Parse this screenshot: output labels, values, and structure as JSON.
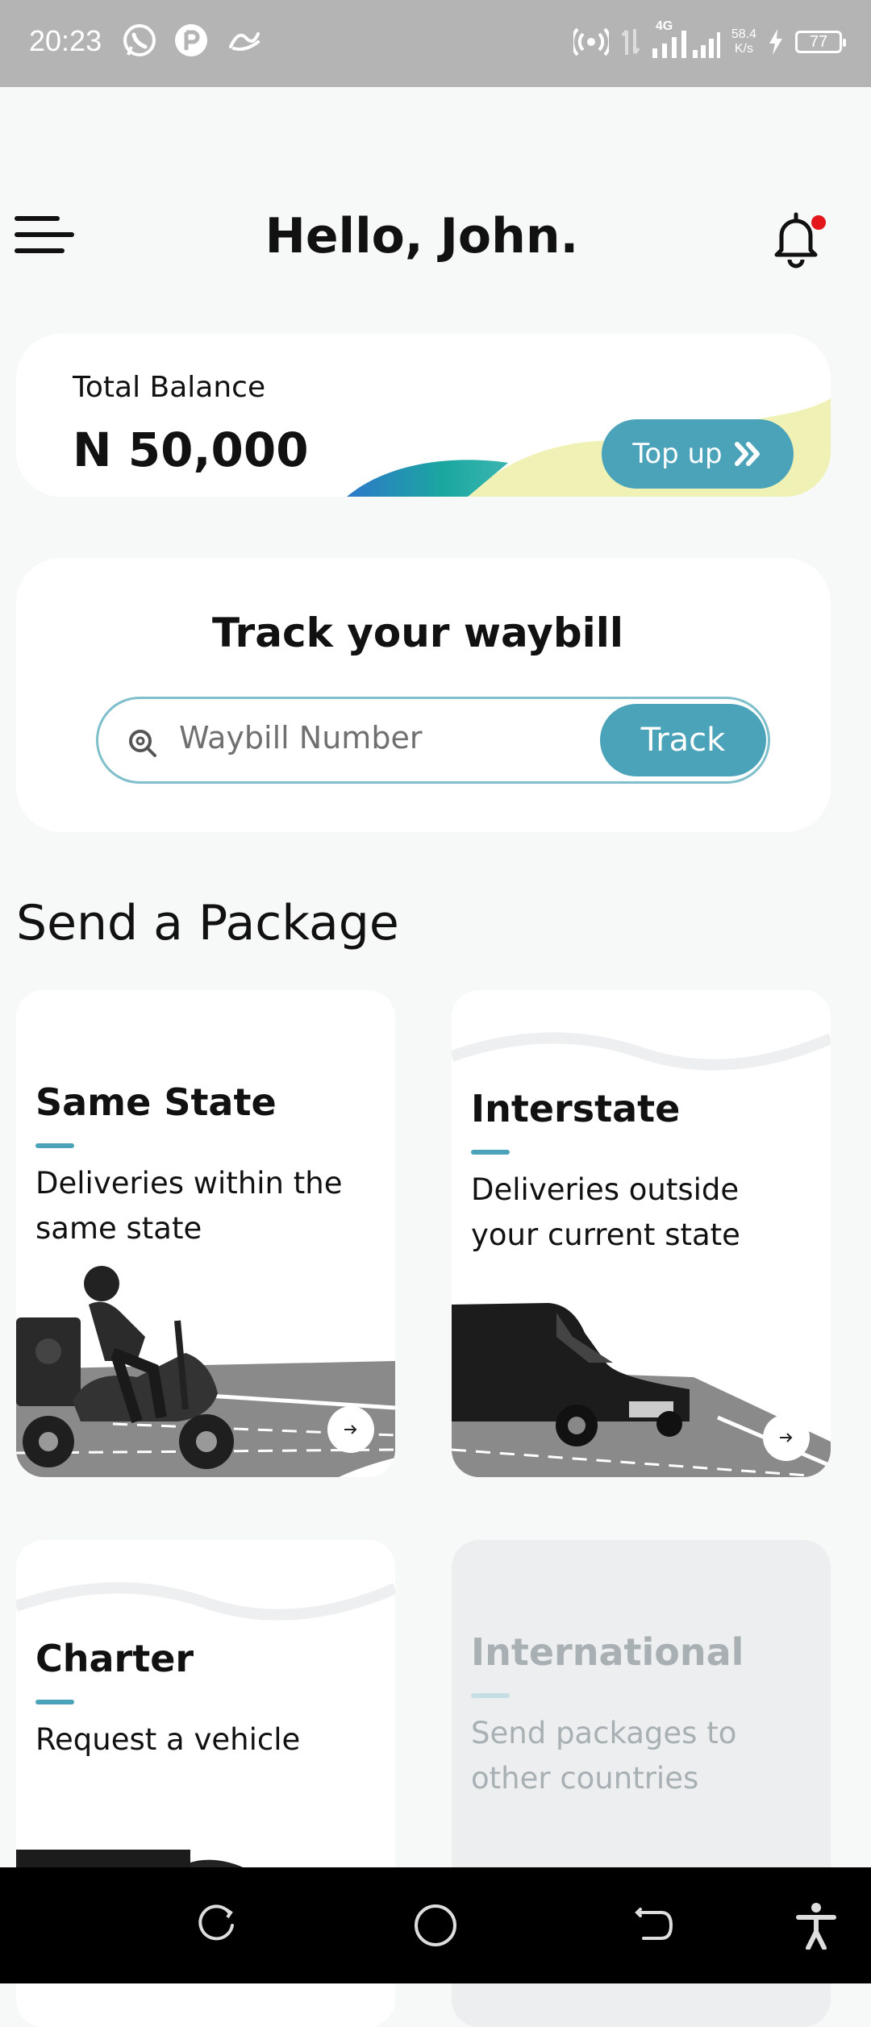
{
  "status_bar": {
    "time": "20:23",
    "network": "4G",
    "speed_value": "58.4",
    "speed_unit": "K/s",
    "battery": "77"
  },
  "header": {
    "title": "Hello, John."
  },
  "balance": {
    "label": "Total Balance",
    "amount": "N 50,000",
    "topup_label": "Top up"
  },
  "track": {
    "title": "Track your waybill",
    "placeholder": "Waybill Number",
    "button_label": "Track"
  },
  "send": {
    "title": "Send a Package",
    "cards": [
      {
        "title": "Same State",
        "description": "Deliveries within the same state",
        "enabled": true
      },
      {
        "title": "Interstate",
        "description": "Deliveries outside your current state",
        "enabled": true
      },
      {
        "title": "Charter",
        "description": "Request a vehicle",
        "enabled": true
      },
      {
        "title": "International",
        "description": "Send packages to other countries",
        "enabled": false
      }
    ]
  },
  "colors": {
    "accent": "#4aa3b8",
    "notification_dot": "#e3161c",
    "status_bar": "#b4b4b4",
    "background": "#f7f8f8"
  }
}
